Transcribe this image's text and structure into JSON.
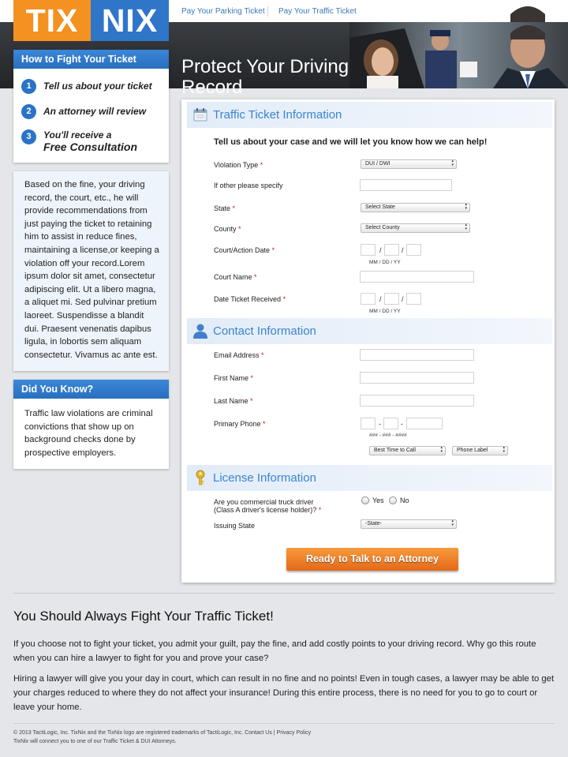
{
  "nav": {
    "link1": "Pay Your Parking Ticket",
    "link2": "Pay Your Traffic Ticket"
  },
  "logo": {
    "part1": "TIX",
    "part2": "NIX"
  },
  "hero": {
    "title": "Protect Your Driving Record"
  },
  "how_to": {
    "title": "How to Fight Your Ticket",
    "steps": [
      {
        "num": "1",
        "text": "Tell us about your ticket"
      },
      {
        "num": "2",
        "text": "An attorney will review"
      },
      {
        "num": "3",
        "line1": "You'll receive a",
        "line2": "Free Consultation"
      }
    ]
  },
  "sidebar_text": "Based on the fine, your driving record, the court, etc., he will provide recommendations from just paying the ticket to retaining him to assist in reduce fines, maintaining a license,or keeping a violation off your record.Lorem ipsum dolor sit amet, consectetur adipiscing elit. Ut a libero magna, a aliquet mi. Sed pulvinar pretium laoreet. Suspendisse a blandit dui. Praesent venenatis dapibus ligula, in lobortis sem aliquam consectetur. Vivamus ac ante est.",
  "did_you_know": {
    "title": "Did You Know?",
    "text": "Traffic law violations are criminal convictions that show up on background checks done by prospective employers."
  },
  "form": {
    "ticket_section": "Traffic Ticket Information",
    "intro": "Tell us about your case and we will let you know how we can help!",
    "violation_type": {
      "label": "Violation Type",
      "value": "DUI / DWI"
    },
    "other_specify": {
      "label": "If other please specify"
    },
    "state": {
      "label": "State",
      "value": "Select State"
    },
    "county": {
      "label": "County",
      "value": "Select County"
    },
    "court_date": {
      "label": "Court/Action Date",
      "hint": "MM / DD / YY"
    },
    "court_name": {
      "label": "Court Name"
    },
    "date_received": {
      "label": "Date Ticket Received",
      "hint": "MM / DD / YY"
    },
    "contact_section": "Contact Information",
    "email": {
      "label": "Email Address"
    },
    "first_name": {
      "label": "First Name"
    },
    "last_name": {
      "label": "Last Name"
    },
    "phone": {
      "label": "Primary Phone",
      "hint": "### - ### - ####",
      "best_time": "Best Time to Call",
      "phone_label": "Phone Label"
    },
    "license_section": "License Information",
    "commercial": {
      "label_line1": "Are you commercial truck driver",
      "label_line2": "(Class A driver's license holder)?",
      "yes": "Yes",
      "no": "No"
    },
    "issuing_state": {
      "label": "Issuing State",
      "value": "-State-"
    },
    "required_mark": "*",
    "slash": "/",
    "dash": "-",
    "submit": "Ready to Talk to an Attorney"
  },
  "bottom": {
    "heading": "You Should Always Fight Your Traffic Ticket!",
    "para1": "If you choose not to fight your ticket, you admit your guilt, pay the fine, and add costly points to your driving record. Why go this route when you can hire a lawyer to fight for you and prove your case?",
    "para2": "Hiring a lawyer will give you your day in court, which can result in no fine and no points! Even in tough cases, a lawyer may be able to get your charges reduced to where they do not affect your insurance! During this entire process, there is no need for you to go to court or leave your home."
  },
  "footer": {
    "copyright": "© 2013 TactiLogic, Inc. TixNix and the TixNix logo are registered trademarks of TactiLogic, Inc.",
    "contact": "Contact Us",
    "sep": "|",
    "privacy": "Privacy Policy",
    "line2": "TixNix will connect you to one of our Traffic Ticket & DUI Attorneys."
  },
  "colors": {
    "brand_orange": "#f39121",
    "brand_blue": "#2f76c9",
    "section_title": "#3b84cf",
    "cta": "#e4691a"
  }
}
